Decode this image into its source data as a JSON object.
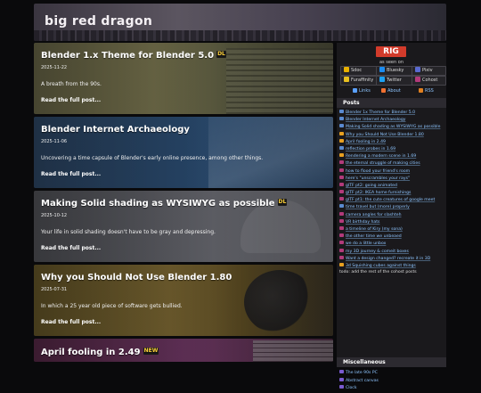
{
  "site": {
    "title": "big red dragon"
  },
  "posts": [
    {
      "title": "Blender 1.x Theme for Blender 5.0",
      "badge": "DL",
      "date": "2025-11-22",
      "excerpt": "A breath from the 90s.",
      "read_more": "Read the full post..."
    },
    {
      "title": "Blender Internet Archaeology",
      "badge": "",
      "date": "2025-11-06",
      "excerpt": "Uncovering a time capsule of Blender's early online presence, among other things.",
      "read_more": "Read the full post..."
    },
    {
      "title": "Making Solid shading as WYSIWYG as possible",
      "badge": "DL",
      "date": "2025-10-12",
      "excerpt": "Your life in solid shading doesn't have to be gray and depressing.",
      "read_more": "Read the full post..."
    },
    {
      "title": "Why you Should Not Use Blender 1.80",
      "badge": "",
      "date": "2025-07-31",
      "excerpt": "In which a 25 year old piece of software gets bullied.",
      "read_more": "Read the full post..."
    },
    {
      "title": "April fooling in 2.49",
      "badge": "NEW",
      "date": "",
      "excerpt": "",
      "read_more": ""
    }
  ],
  "sidebar": {
    "logo": "RIG",
    "as_seen_on": "as seen on",
    "socials": [
      {
        "label": "Sdoc",
        "icon": "duck-icon"
      },
      {
        "label": "Bluesky",
        "icon": "bluesky-icon"
      },
      {
        "label": "Pixiv",
        "icon": "pixiv-icon"
      },
      {
        "label": "Furaffinity",
        "icon": "furaffinity-icon"
      },
      {
        "label": "Twitter",
        "icon": "twitter-icon"
      },
      {
        "label": "Cohost",
        "icon": "cohost-icon"
      }
    ],
    "links": [
      {
        "label": "Links",
        "icon": "links-icon"
      },
      {
        "label": "About",
        "icon": "about-icon"
      },
      {
        "label": "RSS",
        "icon": "rss-icon"
      }
    ],
    "posts_heading": "Posts",
    "post_links": [
      {
        "label": "Blender 1x Theme for Blender 5.0",
        "color": "#5a8ad0"
      },
      {
        "label": "Blender Internet Archaeology",
        "color": "#5a8ad0"
      },
      {
        "label": "Making Solid shading as WYSIWYG as possible",
        "color": "#5a8ad0"
      },
      {
        "label": "Why you Should Not Use Blender 1.80",
        "color": "#e8a020"
      },
      {
        "label": "April fooling in 2.49",
        "color": "#e8a020"
      },
      {
        "label": "reflection probes in 1.69",
        "color": "#5a8ad0"
      },
      {
        "label": "Rendering a modern scene in 1.69",
        "color": "#e8a020"
      },
      {
        "label": "the eternal struggle of making cities",
        "color": "#b23a7a"
      },
      {
        "label": "how to flood your friend's room",
        "color": "#b23a7a"
      },
      {
        "label": "here's \"unscrambles your rays\"",
        "color": "#b23a7a"
      },
      {
        "label": "glTF pt2: going animated",
        "color": "#b23a7a"
      },
      {
        "label": "glTF pt2: IKEA home furnishings",
        "color": "#b23a7a"
      },
      {
        "label": "glTF pt1: the cute creatures of google meet",
        "color": "#b23a7a"
      },
      {
        "label": "time travel but (more) properly",
        "color": "#5a8ad0"
      },
      {
        "label": "camera angles for slashteh",
        "color": "#b23a7a"
      },
      {
        "label": "VR birthday hats",
        "color": "#b23a7a"
      },
      {
        "label": "a timeline of Kiry (my sona)",
        "color": "#b23a7a"
      },
      {
        "label": "the other time we unbeaed",
        "color": "#b23a7a"
      },
      {
        "label": "we do a little unbox",
        "color": "#b23a7a"
      },
      {
        "label": "my 3D journey & comeit boxes",
        "color": "#b23a7a"
      },
      {
        "label": "Want a design changed? recreate it in 3D",
        "color": "#b23a7a"
      },
      {
        "label": "3d Squishing cubes against things",
        "color": "#e8a020"
      }
    ],
    "todo_text": "todo: add the rest of the cohost posts",
    "misc_heading": "Miscellaneous",
    "misc_links": [
      {
        "label": "The late 90s PC"
      },
      {
        "label": "Abstract canvas"
      },
      {
        "label": "Clock"
      }
    ]
  }
}
